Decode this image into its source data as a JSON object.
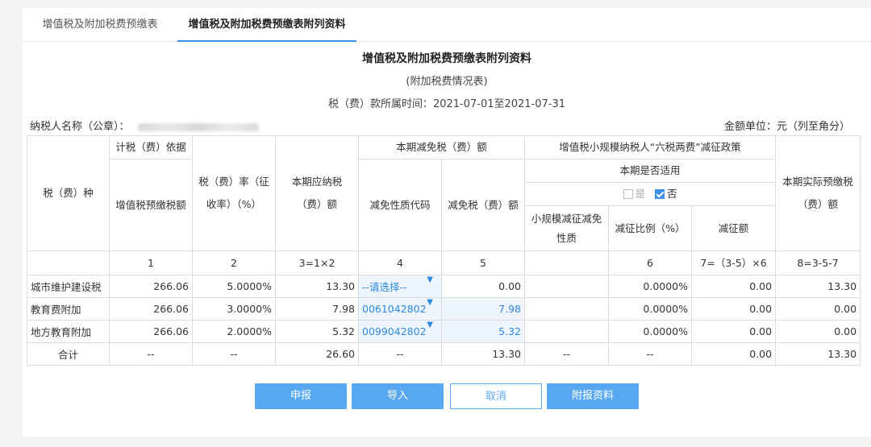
{
  "tabs": [
    {
      "label": "增值税及附加税费预缴表"
    },
    {
      "label": "增值税及附加税费预缴表附列资料"
    }
  ],
  "header": {
    "title": "增值税及附加税费预缴表附列资料",
    "subtitle": "(附加税费情况表)",
    "period": "税（费）款所属时间：2021-07-01至2021-07-31",
    "taxpayer_label": "纳税人名称（公章）：",
    "unit": "金额单位：元（列至角分）"
  },
  "table": {
    "h_tax_type": "税（费）种",
    "h_basis": "计税（费）依据",
    "h_basis_sub": "增值税预缴税额",
    "h_rate": "税（费）率（征收率）（%）",
    "h_payable": "本期应纳税（费）额",
    "h_relief": "本期减免税（费）额",
    "h_relief_code": "减免性质代码",
    "h_relief_amount": "减免税（费）额",
    "h_policy": "增值税小规模纳税人“六税两费”减征政策",
    "h_applicable": "本期是否适用",
    "opt_yes": "是",
    "opt_no": "否",
    "h_small_nature": "小规模减征减免性质",
    "h_reduce_ratio": "减征比例（%）",
    "h_reduce_amount": "减征额",
    "h_actual": "本期实际预缴税（费）额",
    "col_nums": [
      "1",
      "2",
      "3=1×2",
      "4",
      "5",
      "6",
      "7=（3-5）×6",
      "8=3-5-7"
    ],
    "rows": [
      {
        "name": "城市维护建设税",
        "basis": "266.06",
        "rate": "5.0000%",
        "payable": "13.30",
        "code": "--请选择--",
        "relief": "0.00",
        "small": "",
        "ratio": "0.0000%",
        "reduce": "0.00",
        "actual": "13.30"
      },
      {
        "name": "教育费附加",
        "basis": "266.06",
        "rate": "3.0000%",
        "payable": "7.98",
        "code": "0061042802",
        "relief": "7.98",
        "small": "",
        "ratio": "0.0000%",
        "reduce": "0.00",
        "actual": "0.00"
      },
      {
        "name": "地方教育附加",
        "basis": "266.06",
        "rate": "2.0000%",
        "payable": "5.32",
        "code": "0099042802",
        "relief": "5.32",
        "small": "",
        "ratio": "0.0000%",
        "reduce": "0.00",
        "actual": "0.00"
      }
    ],
    "total": {
      "name": "合计",
      "basis": "--",
      "rate": "--",
      "payable": "26.60",
      "code": "--",
      "relief": "13.30",
      "small": "--",
      "ratio": "--",
      "reduce": "0.00",
      "actual": "13.30"
    }
  },
  "buttons": {
    "declare": "申报",
    "import": "导入",
    "cancel": "取消",
    "attach": "附报资料"
  },
  "icons": {
    "dropdown": "caret-down-icon",
    "checkbox": "checkbox-icon"
  },
  "colors": {
    "accent": "#3d8fe8",
    "button": "#59a9f2",
    "edit_bg": "#eef5fd"
  }
}
